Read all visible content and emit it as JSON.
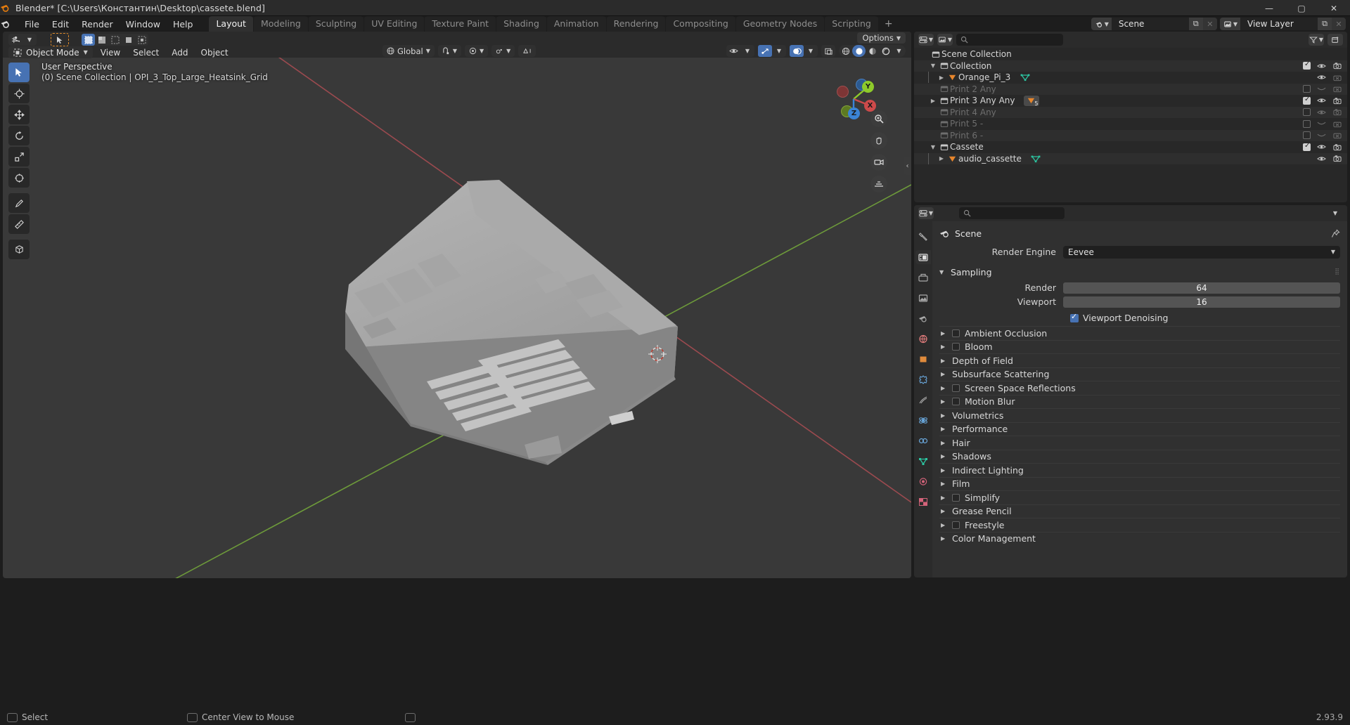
{
  "window": {
    "title": "Blender* [C:\\Users\\Константин\\Desktop\\cassete.blend]",
    "minimize": "—",
    "maximize": "▢",
    "close": "✕"
  },
  "topbar": {
    "menus": [
      "File",
      "Edit",
      "Render",
      "Window",
      "Help"
    ],
    "workspaces": [
      "Layout",
      "Modeling",
      "Sculpting",
      "UV Editing",
      "Texture Paint",
      "Shading",
      "Animation",
      "Rendering",
      "Compositing",
      "Geometry Nodes",
      "Scripting"
    ],
    "active_workspace": "Layout",
    "add_workspace": "+",
    "scene_name": "Scene",
    "view_layer_name": "View Layer"
  },
  "viewport": {
    "mode": "Object Mode",
    "header_menus": [
      "View",
      "Select",
      "Add",
      "Object"
    ],
    "transform_orientation": "Global",
    "options_label": "Options",
    "overlay_line1": "User Perspective",
    "overlay_line2": "(0) Scene Collection | OPI_3_Top_Large_Heatsink_Grid",
    "gizmo_axes": [
      "X",
      "Y",
      "Z"
    ],
    "axis_colors": {
      "x": "#cd4a4a",
      "y": "#8ecb2a",
      "z": "#3b84d6",
      "x_dim": "#7d3535",
      "y_dim": "#5d7a22",
      "z_dim": "#2c5a91"
    },
    "toolbar_tools": [
      "select-box-tool",
      "cursor-tool",
      "move-tool",
      "rotate-tool",
      "scale-tool",
      "transform-tool",
      "annotate-tool",
      "measure-tool",
      "add-cube-tool"
    ],
    "background_color": "#393939"
  },
  "outliner": {
    "display_mode": "view-layer",
    "search_placeholder": "",
    "rows": [
      {
        "label": "Scene Collection",
        "indent": 0,
        "icon": "collection-icon",
        "twisty": "",
        "dim": false,
        "checkbox": null,
        "eye": null,
        "camera": null
      },
      {
        "label": "Collection",
        "indent": 1,
        "icon": "collection-icon",
        "twisty": "▼",
        "dim": false,
        "checkbox": true,
        "eye": "on",
        "camera": "on"
      },
      {
        "label": "Orange_Pi_3",
        "indent": 2,
        "icon": "mesh-object-icon",
        "twisty": "▶",
        "dim": false,
        "checkbox": null,
        "eye": "on",
        "camera": "off"
      },
      {
        "label": "Print 2 Any",
        "indent": 1,
        "icon": "collection-icon",
        "twisty": "",
        "dim": true,
        "checkbox": false,
        "eye": "closed",
        "camera": "off"
      },
      {
        "label": "Print 3 Any Any",
        "indent": 1,
        "icon": "collection-icon",
        "twisty": "▶",
        "dim": false,
        "checkbox": true,
        "eye": "on",
        "camera": "on"
      },
      {
        "label": "Print 4 Any",
        "indent": 1,
        "icon": "collection-icon",
        "twisty": "",
        "dim": true,
        "checkbox": false,
        "eye": "on",
        "camera": "on"
      },
      {
        "label": "Print 5 -",
        "indent": 1,
        "icon": "collection-icon",
        "twisty": "",
        "dim": true,
        "checkbox": false,
        "eye": "closed",
        "camera": "off"
      },
      {
        "label": "Print 6 -",
        "indent": 1,
        "icon": "collection-icon",
        "twisty": "",
        "dim": true,
        "checkbox": false,
        "eye": "closed",
        "camera": "off"
      },
      {
        "label": "Cassete",
        "indent": 1,
        "icon": "collection-icon",
        "twisty": "▼",
        "dim": false,
        "checkbox": true,
        "eye": "on",
        "camera": "on"
      },
      {
        "label": "audio_cassette",
        "indent": 2,
        "icon": "mesh-object-icon",
        "twisty": "▶",
        "dim": false,
        "checkbox": null,
        "eye": "on",
        "camera": "on"
      }
    ],
    "badge_count": "5"
  },
  "properties": {
    "breadcrumb": "Scene",
    "render_engine_label": "Render Engine",
    "render_engine_value": "Eevee",
    "sampling": {
      "title": "Sampling",
      "render_label": "Render",
      "render_value": "64",
      "viewport_label": "Viewport",
      "viewport_value": "16",
      "denoising_label": "Viewport Denoising"
    },
    "sections": [
      {
        "label": "Ambient Occlusion",
        "has_checkbox": true
      },
      {
        "label": "Bloom",
        "has_checkbox": true
      },
      {
        "label": "Depth of Field",
        "has_checkbox": false
      },
      {
        "label": "Subsurface Scattering",
        "has_checkbox": false
      },
      {
        "label": "Screen Space Reflections",
        "has_checkbox": true
      },
      {
        "label": "Motion Blur",
        "has_checkbox": true
      },
      {
        "label": "Volumetrics",
        "has_checkbox": false
      },
      {
        "label": "Performance",
        "has_checkbox": false
      },
      {
        "label": "Hair",
        "has_checkbox": false
      },
      {
        "label": "Shadows",
        "has_checkbox": false
      },
      {
        "label": "Indirect Lighting",
        "has_checkbox": false
      },
      {
        "label": "Film",
        "has_checkbox": false
      },
      {
        "label": "Simplify",
        "has_checkbox": true
      },
      {
        "label": "Grease Pencil",
        "has_checkbox": false
      },
      {
        "label": "Freestyle",
        "has_checkbox": true
      },
      {
        "label": "Color Management",
        "has_checkbox": false
      }
    ],
    "tabs": [
      "tool-tab",
      "render-tab",
      "output-tab",
      "view-layer-tab",
      "scene-tab",
      "world-tab",
      "object-tab",
      "modifier-tab",
      "particles-tab",
      "physics-tab",
      "constraint-tab",
      "data-tab",
      "material-tab",
      "texture-tab"
    ]
  },
  "statusbar": {
    "select_label": "Select",
    "center_view_label": "Center View to Mouse",
    "version": "2.93.9"
  }
}
